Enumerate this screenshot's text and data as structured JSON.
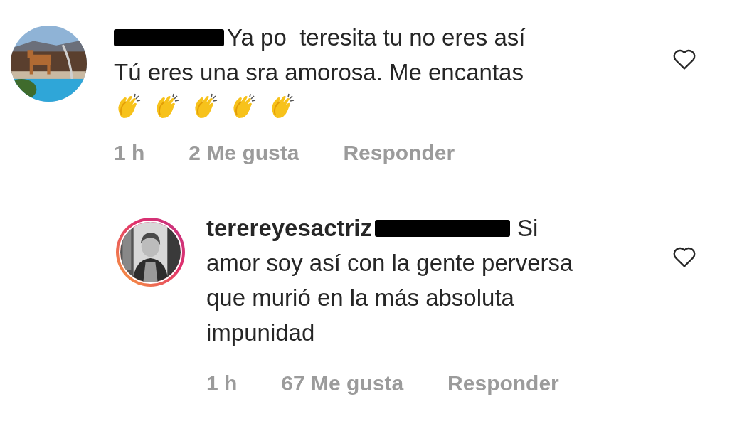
{
  "comments": [
    {
      "username_redacted": true,
      "lines": [
        "Ya po  teresita tu no eres así",
        "Tú eres una sra amorosa. Me encantas"
      ],
      "time": "1 h",
      "likes": "2 Me gusta",
      "reply": "Responder",
      "liked": false,
      "story_ring": false,
      "is_reply": false
    },
    {
      "username_redacted": false,
      "username": "terereyesactriz",
      "mention_redacted": true,
      "lines": [
        "Si",
        "amor soy así con la gente perversa que murió en la más absoluta impunidad"
      ],
      "time": "1 h",
      "likes": "67 Me gusta",
      "reply": "Responder",
      "liked": false,
      "story_ring": true,
      "is_reply": true
    }
  ]
}
